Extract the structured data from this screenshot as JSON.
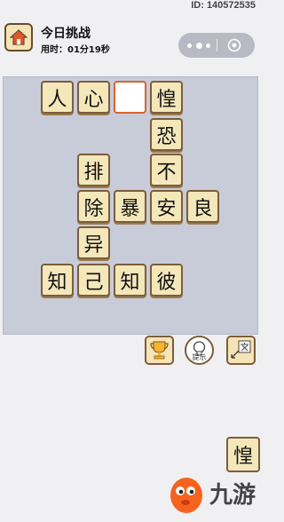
{
  "header": {
    "id_label": "ID: 140572535",
    "title": "今日挑战",
    "timer": "用时：01分19秒"
  },
  "board": {
    "cells": {
      "r0c0": "人",
      "r0c1": "心",
      "r0c2": "",
      "r0c3": "惶",
      "r1c3": "恐",
      "r2c1": "排",
      "r2c3": "不",
      "r3c1": "除",
      "r3c2": "暴",
      "r3c3": "安",
      "r3c4": "良",
      "r4c1": "异",
      "r5c0": "知",
      "r5c1": "己",
      "r5c2": "知",
      "r5c3": "彼"
    }
  },
  "tools": {
    "hint_label": "提示"
  },
  "candidates": [
    "惶"
  ],
  "watermark": {
    "text": "九游"
  },
  "colors": {
    "tile_bg": "#f4e7ba",
    "tile_border": "#7c5d3a",
    "selected_border": "#d9632f",
    "board_bg": "#c8ccd9"
  }
}
